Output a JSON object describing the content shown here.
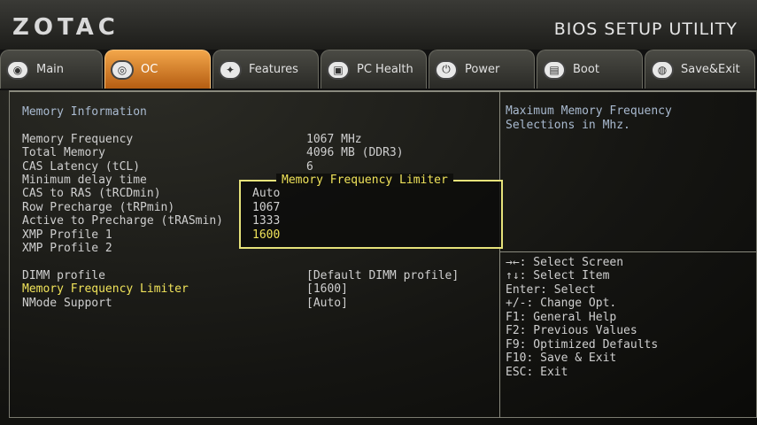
{
  "header": {
    "brand": "ZOTAC",
    "utility_title": "BIOS SETUP UTILITY"
  },
  "tabs": [
    {
      "label": "Main",
      "icon": "circle-icon",
      "active": false
    },
    {
      "label": "OC",
      "icon": "gauge-icon",
      "active": true
    },
    {
      "label": "Features",
      "icon": "wrench-icon",
      "active": false
    },
    {
      "label": "PC Health",
      "icon": "monitor-icon",
      "active": false
    },
    {
      "label": "Power",
      "icon": "power-icon",
      "active": false
    },
    {
      "label": "Boot",
      "icon": "lock-icon",
      "active": false
    },
    {
      "label": "Save&Exit",
      "icon": "disk-icon",
      "active": false
    }
  ],
  "section_title": "Memory Information",
  "info_rows": [
    {
      "label": "Memory Frequency",
      "value": "1067 MHz"
    },
    {
      "label": "Total Memory",
      "value": "4096 MB (DDR3)"
    },
    {
      "label": "CAS Latency (tCL)",
      "value": "6"
    },
    {
      "label": "Minimum delay time",
      "value": ""
    },
    {
      "label": "CAS to RAS (tRCDmin)",
      "value": ""
    },
    {
      "label": "Row Precharge (tRPmin)",
      "value": ""
    },
    {
      "label": "Active to Precharge (tRASmin)",
      "value": ""
    },
    {
      "label": "XMP Profile 1",
      "value": ""
    },
    {
      "label": "XMP Profile 2",
      "value": ""
    }
  ],
  "settings": [
    {
      "label": "DIMM profile",
      "value": "[Default DIMM profile]",
      "selected": false
    },
    {
      "label": "Memory Frequency Limiter",
      "value": "[1600]",
      "selected": true
    },
    {
      "label": "NMode Support",
      "value": "[Auto]",
      "selected": false
    }
  ],
  "popup": {
    "title": "Memory Frequency Limiter",
    "options": [
      "Auto",
      "1067",
      "1333",
      "1600"
    ],
    "selected": "1600"
  },
  "help": {
    "line1": "Maximum Memory Frequency",
    "line2": "Selections in Mhz."
  },
  "keys": [
    "→←: Select Screen",
    "↑↓: Select Item",
    "Enter: Select",
    "+/-: Change Opt.",
    "F1: General Help",
    "F2: Previous Values",
    "F9: Optimized Defaults",
    "F10: Save & Exit",
    "ESC: Exit"
  ]
}
